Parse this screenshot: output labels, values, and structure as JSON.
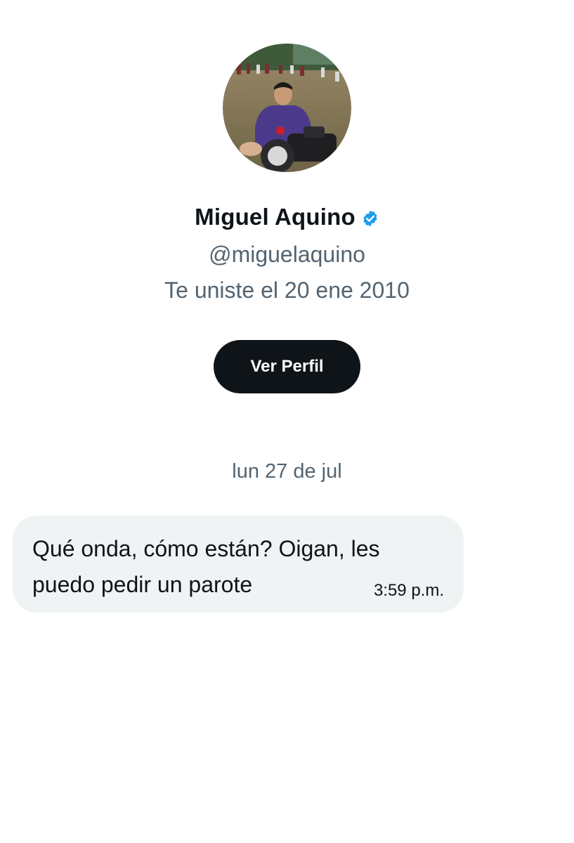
{
  "profile": {
    "avatar_alt": "profile photo",
    "name": "Miguel Aquino",
    "verified_icon": "verified-badge-icon",
    "handle": "@miguelaquino",
    "joined": "Te uniste el 20 ene 2010",
    "view_profile_label": "Ver Perfil"
  },
  "conversation": {
    "date_separator": "lun 27 de jul",
    "messages": [
      {
        "text": "Qué onda, cómo están? Oigan, les puedo pedir un parote",
        "time": "3:59 p.m."
      }
    ]
  },
  "colors": {
    "primary_text": "#0f1419",
    "secondary_text": "#536471",
    "verified_blue": "#1d9bf0",
    "bubble_bg": "#eff3f4",
    "button_bg": "#0f1419"
  }
}
